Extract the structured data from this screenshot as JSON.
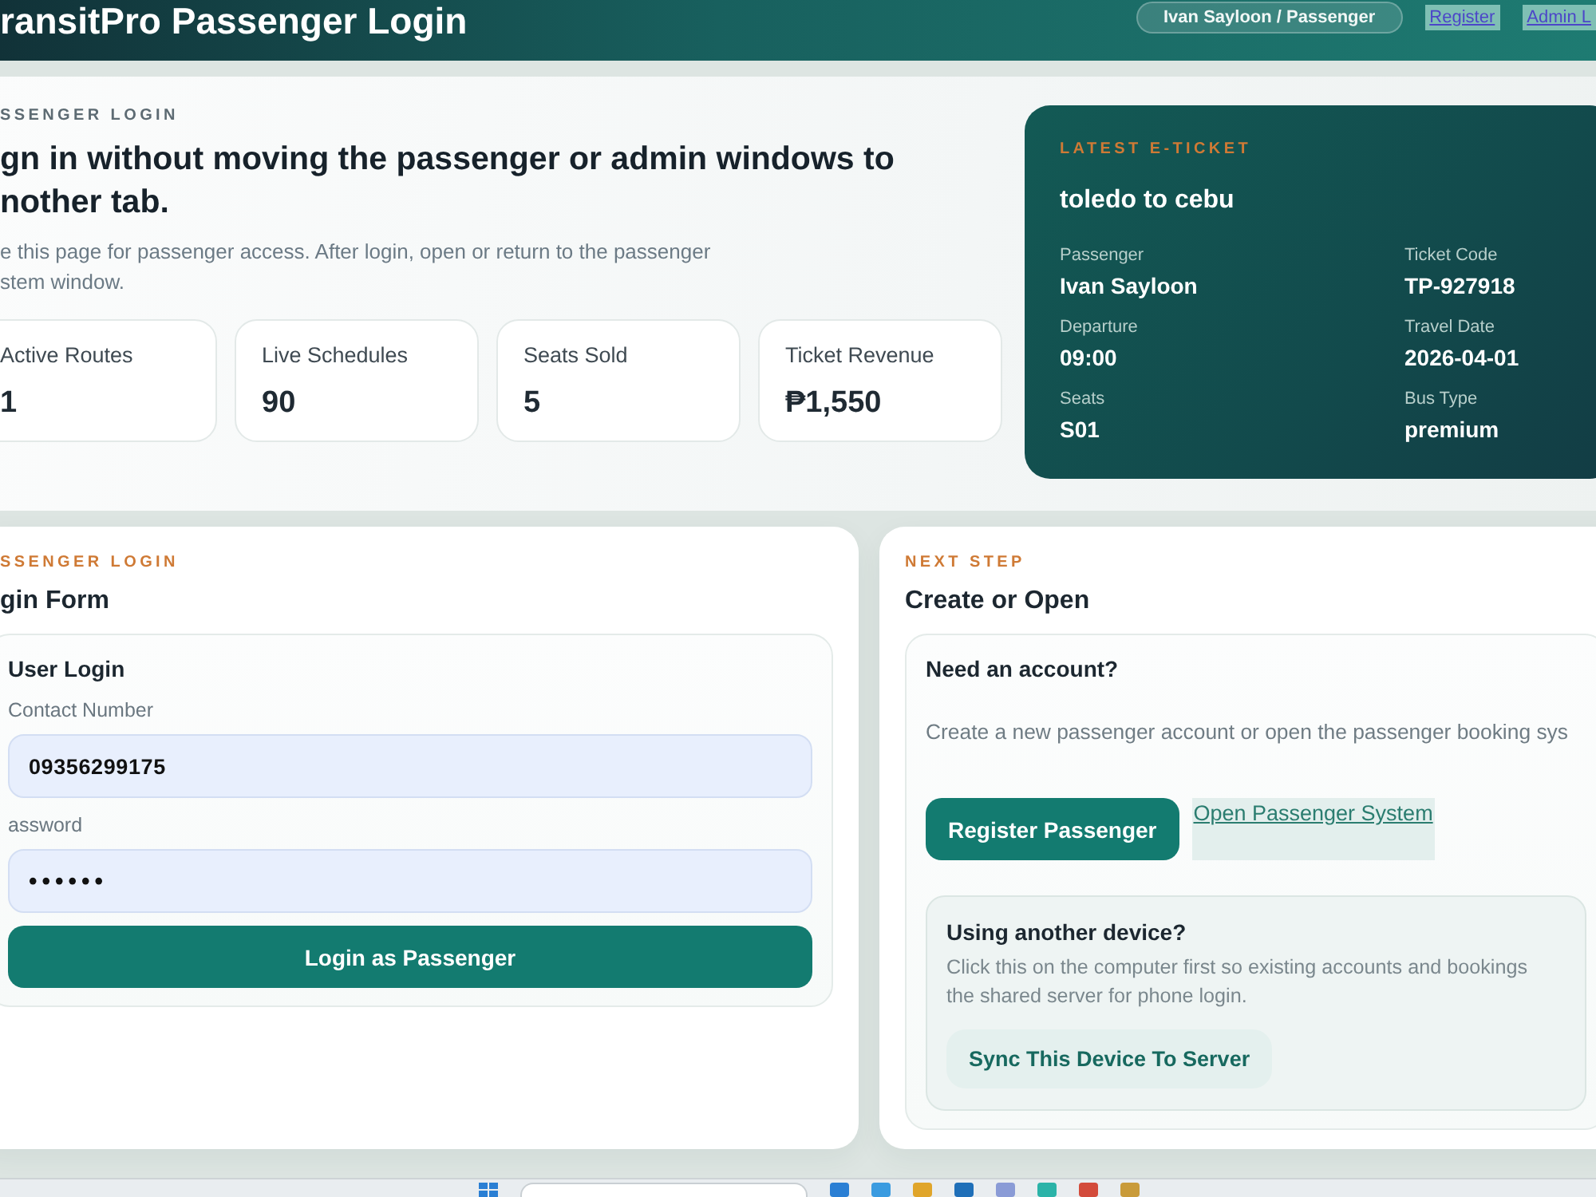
{
  "header": {
    "title": "ransitPro Passenger Login",
    "user_pill": "Ivan Sayloon / Passenger",
    "links": [
      "Register",
      "Admin L"
    ]
  },
  "hero": {
    "eyebrow": "SSENGER LOGIN",
    "heading_lines": [
      "gn in without moving the passenger or admin windows to",
      "nother tab."
    ],
    "description_lines": [
      "e this page for passenger access. After login, open or return to the passenger",
      "stem window."
    ],
    "stats": [
      {
        "label": "Active Routes",
        "value": "1"
      },
      {
        "label": "Live Schedules",
        "value": "90"
      },
      {
        "label": "Seats Sold",
        "value": "5"
      },
      {
        "label": "Ticket Revenue",
        "value": "₱1,550"
      }
    ]
  },
  "ticket": {
    "eyebrow": "LATEST E-TICKET",
    "route": "toledo to cebu",
    "fields": [
      {
        "label": "Passenger",
        "value": "Ivan Sayloon"
      },
      {
        "label": "Ticket Code",
        "value": "TP-927918"
      },
      {
        "label": "Departure",
        "value": "09:00"
      },
      {
        "label": "Travel Date",
        "value": "2026-04-01"
      },
      {
        "label": "Seats",
        "value": "S01"
      },
      {
        "label": "Bus Type",
        "value": "premium"
      }
    ]
  },
  "login_card": {
    "eyebrow": "SSENGER LOGIN",
    "title": "gin Form",
    "panel_title": "User Login",
    "fields": [
      {
        "kind": "text",
        "label": "Contact Number",
        "value": "09356299175"
      },
      {
        "kind": "password",
        "label": "assword",
        "value": "••••••"
      }
    ],
    "submit": "Login as Passenger"
  },
  "next_card": {
    "eyebrow": "NEXT STEP",
    "title": "Create or Open",
    "panel_title": "Need an account?",
    "description": "Create a new passenger account or open the passenger booking sys",
    "primary_button": "Register Passenger",
    "link": "Open Passenger System",
    "device": {
      "title": "Using another device?",
      "text_lines": [
        "Click this on the computer first so existing accounts and bookings",
        "the shared server for phone login."
      ],
      "button": "Sync This Device To Server"
    }
  }
}
